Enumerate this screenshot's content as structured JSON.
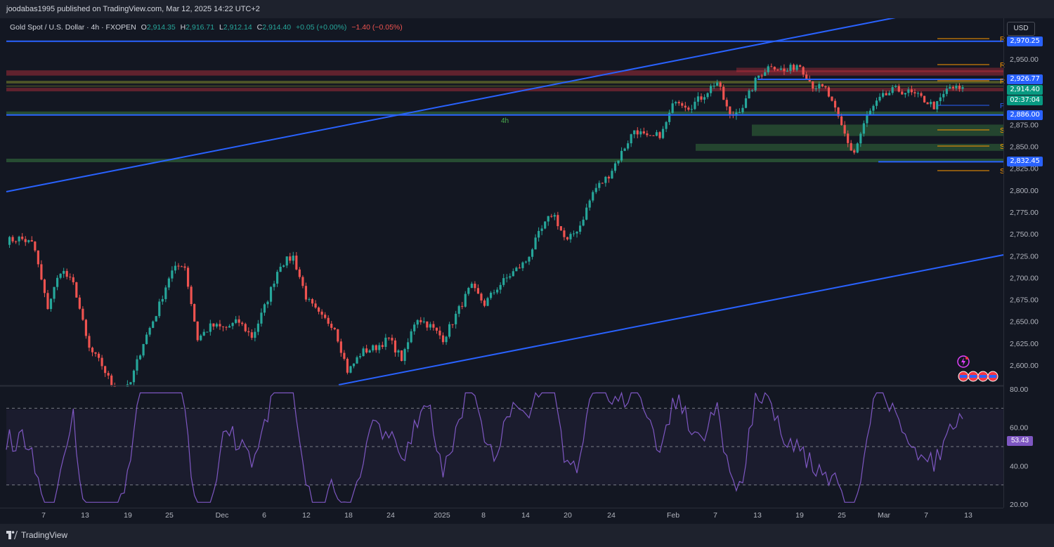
{
  "header": {
    "published": "joodabas1995 published on TradingView.com, Mar 12, 2025 14:22 UTC+2"
  },
  "legend": {
    "symbol": "Gold Spot / U.S. Dollar · 4h · FXOPEN",
    "open_label": "O",
    "open": "2,914.35",
    "high_label": "H",
    "high": "2,916.71",
    "low_label": "L",
    "low": "2,912.14",
    "close_label": "C",
    "close": "2,914.40",
    "change": "+0.05 (+0.00%)",
    "change_bid": "−1.40 (−0.05%)"
  },
  "currency_button": "USD",
  "timeframe_label": "4h",
  "price_axis": {
    "ticks": [
      "2,950.00",
      "2,875.00",
      "2,850.00",
      "2,800.00",
      "2,775.00",
      "2,750.00",
      "2,725.00",
      "2,700.00",
      "2,675.00",
      "2,650.00",
      "2,625.00",
      "2,600.00"
    ],
    "tick_values": [
      2950,
      2875,
      2850,
      2800,
      2775,
      2750,
      2725,
      2700,
      2675,
      2650,
      2625,
      2600
    ],
    "badges": [
      {
        "label": "2,970.25",
        "value": 2970.25,
        "color": "#2962ff"
      },
      {
        "label": "2,926.77",
        "value": 2926.77,
        "color": "#2962ff"
      },
      {
        "label": "2,914.40",
        "value": 2914.4,
        "color": "#089981"
      },
      {
        "label": "02:37:04",
        "value": 2902.5,
        "color": "#089981"
      },
      {
        "label": "2,886.00",
        "value": 2886.0,
        "color": "#2962ff"
      },
      {
        "label": "2,832.45",
        "value": 2832.45,
        "color": "#2962ff"
      }
    ],
    "partial_label": "2,825.00"
  },
  "pivot_labels": [
    "R",
    "R",
    "R",
    "P",
    "S",
    "S",
    "S"
  ],
  "rsi": {
    "value_label": "53.43",
    "ticks": [
      "80.00",
      "60.00",
      "40.00",
      "20.00"
    ],
    "tick_values": [
      80,
      60,
      40,
      20
    ],
    "upper_band": 70,
    "lower_band": 30,
    "color": "#7e57c2"
  },
  "time_axis": {
    "labels": [
      "7",
      "13",
      "19",
      "25",
      "Dec",
      "6",
      "12",
      "18",
      "24",
      "2025",
      "8",
      "14",
      "20",
      "24",
      "Feb",
      "7",
      "13",
      "19",
      "25",
      "Mar",
      "7",
      "13"
    ]
  },
  "footer": {
    "brand": "TradingView"
  },
  "colors": {
    "up": "#26a69a",
    "down": "#ef5350",
    "background": "#131722",
    "channel": "#2962ff",
    "resistance_zone": "#f23645",
    "support_zone": "#4caf50"
  },
  "chart_data": {
    "type": "candlestick",
    "symbol": "Gold Spot / U.S. Dollar",
    "timeframe": "4h",
    "y_range": [
      2583,
      2985
    ],
    "approx_close_path": [
      {
        "date": "Nov 2",
        "close": 2742
      },
      {
        "date": "Nov 4",
        "close": 2745
      },
      {
        "date": "Nov 5",
        "close": 2738
      },
      {
        "date": "Nov 6",
        "close": 2665
      },
      {
        "date": "Nov 7",
        "close": 2710
      },
      {
        "date": "Nov 8",
        "close": 2690
      },
      {
        "date": "Nov 11",
        "close": 2620
      },
      {
        "date": "Nov 13",
        "close": 2600
      },
      {
        "date": "Nov 14",
        "close": 2568
      },
      {
        "date": "Nov 15",
        "close": 2575
      },
      {
        "date": "Nov 18",
        "close": 2625
      },
      {
        "date": "Nov 20",
        "close": 2660
      },
      {
        "date": "Nov 22",
        "close": 2705
      },
      {
        "date": "Nov 25",
        "close": 2718
      },
      {
        "date": "Nov 26",
        "close": 2630
      },
      {
        "date": "Nov 28",
        "close": 2645
      },
      {
        "date": "Dec 2",
        "close": 2642
      },
      {
        "date": "Dec 4",
        "close": 2650
      },
      {
        "date": "Dec 6",
        "close": 2632
      },
      {
        "date": "Dec 9",
        "close": 2670
      },
      {
        "date": "Dec 11",
        "close": 2715
      },
      {
        "date": "Dec 12",
        "close": 2724
      },
      {
        "date": "Dec 13",
        "close": 2675
      },
      {
        "date": "Dec 16",
        "close": 2655
      },
      {
        "date": "Dec 18",
        "close": 2645
      },
      {
        "date": "Dec 19",
        "close": 2592
      },
      {
        "date": "Dec 20",
        "close": 2615
      },
      {
        "date": "Dec 24",
        "close": 2620
      },
      {
        "date": "Dec 27",
        "close": 2630
      },
      {
        "date": "Dec 30",
        "close": 2606
      },
      {
        "date": "Jan 2",
        "close": 2655
      },
      {
        "date": "Jan 4",
        "close": 2645
      },
      {
        "date": "Jan 6",
        "close": 2630
      },
      {
        "date": "Jan 8",
        "close": 2660
      },
      {
        "date": "Jan 10",
        "close": 2690
      },
      {
        "date": "Jan 13",
        "close": 2670
      },
      {
        "date": "Jan 15",
        "close": 2690
      },
      {
        "date": "Jan 17",
        "close": 2705
      },
      {
        "date": "Jan 20",
        "close": 2718
      },
      {
        "date": "Jan 22",
        "close": 2750
      },
      {
        "date": "Jan 24",
        "close": 2775
      },
      {
        "date": "Jan 27",
        "close": 2740
      },
      {
        "date": "Jan 29",
        "close": 2760
      },
      {
        "date": "Jan 31",
        "close": 2800
      },
      {
        "date": "Feb 3",
        "close": 2815
      },
      {
        "date": "Feb 4",
        "close": 2842
      },
      {
        "date": "Feb 5",
        "close": 2870
      },
      {
        "date": "Feb 6",
        "close": 2858
      },
      {
        "date": "Feb 7",
        "close": 2865
      },
      {
        "date": "Feb 10",
        "close": 2905
      },
      {
        "date": "Feb 11",
        "close": 2895
      },
      {
        "date": "Feb 12",
        "close": 2908
      },
      {
        "date": "Feb 13",
        "close": 2925
      },
      {
        "date": "Feb 14",
        "close": 2883
      },
      {
        "date": "Feb 17",
        "close": 2898
      },
      {
        "date": "Feb 18",
        "close": 2930
      },
      {
        "date": "Feb 20",
        "close": 2944
      },
      {
        "date": "Feb 21",
        "close": 2935
      },
      {
        "date": "Feb 24",
        "close": 2945
      },
      {
        "date": "Feb 25",
        "close": 2920
      },
      {
        "date": "Feb 26",
        "close": 2915
      },
      {
        "date": "Feb 27",
        "close": 2878
      },
      {
        "date": "Feb 28",
        "close": 2840
      },
      {
        "date": "Mar 3",
        "close": 2885
      },
      {
        "date": "Mar 4",
        "close": 2905
      },
      {
        "date": "Mar 5",
        "close": 2915
      },
      {
        "date": "Mar 6",
        "close": 2912
      },
      {
        "date": "Mar 7",
        "close": 2905
      },
      {
        "date": "Mar 10",
        "close": 2895
      },
      {
        "date": "Mar 11",
        "close": 2918
      },
      {
        "date": "Mar 12",
        "close": 2914.4
      }
    ],
    "horizontal_levels": [
      2970.25,
      2926.77,
      2886.0,
      2832.45
    ],
    "resistance_zones": [
      [
        2930,
        2937
      ],
      [
        2913,
        2917
      ]
    ],
    "support_zones": [
      [
        2886,
        2890
      ],
      [
        2832,
        2835
      ]
    ],
    "channel": {
      "upper": [
        [
          2500,
          2800
        ],
        [
          2990,
          2990
        ]
      ],
      "lower": [
        [
          2575,
          2583
        ],
        [
          2722,
          2725
        ]
      ]
    }
  }
}
